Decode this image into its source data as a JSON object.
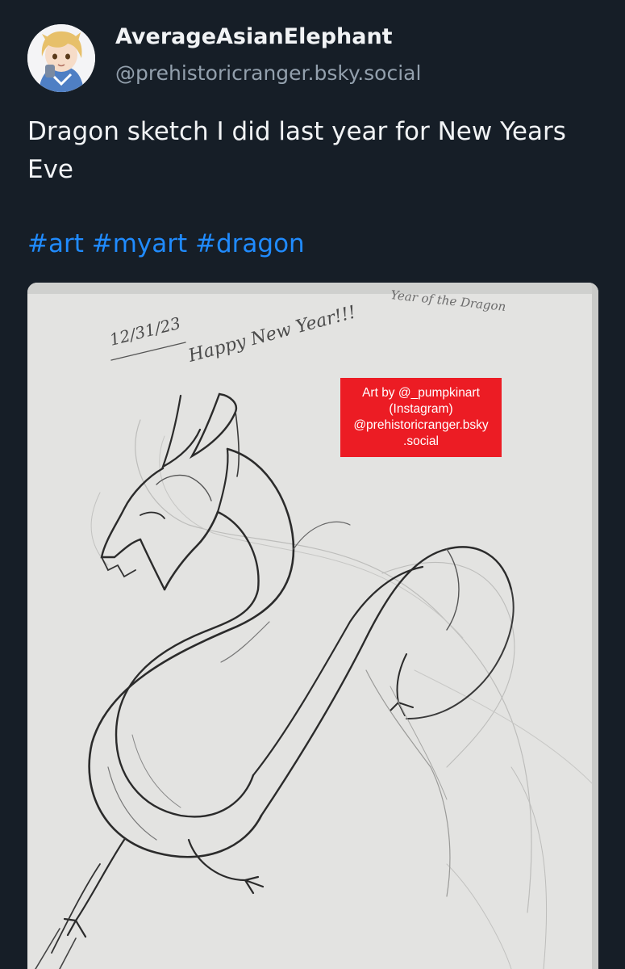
{
  "author": {
    "display_name": "AverageAsianElephant",
    "handle": "@prehistoricranger.bsky.social"
  },
  "post": {
    "text": "Dragon sketch I did last year for New Years Eve",
    "hashtags": [
      "#art",
      "#myart",
      "#dragon"
    ]
  },
  "media": {
    "handwritten": {
      "date": "12/31/23",
      "greeting": "Happy New Year!!!",
      "subtitle": "Year of the Dragon"
    },
    "credit_lines": [
      "Art by @_pumpkinart",
      "(Instagram)",
      "@prehistoricranger.bsky",
      ".social"
    ]
  },
  "colors": {
    "background": "#161e27",
    "link": "#208bfe",
    "handle": "#93a0ad",
    "credit_badge": "#ec1c24",
    "paper": "#e3e3e1"
  }
}
